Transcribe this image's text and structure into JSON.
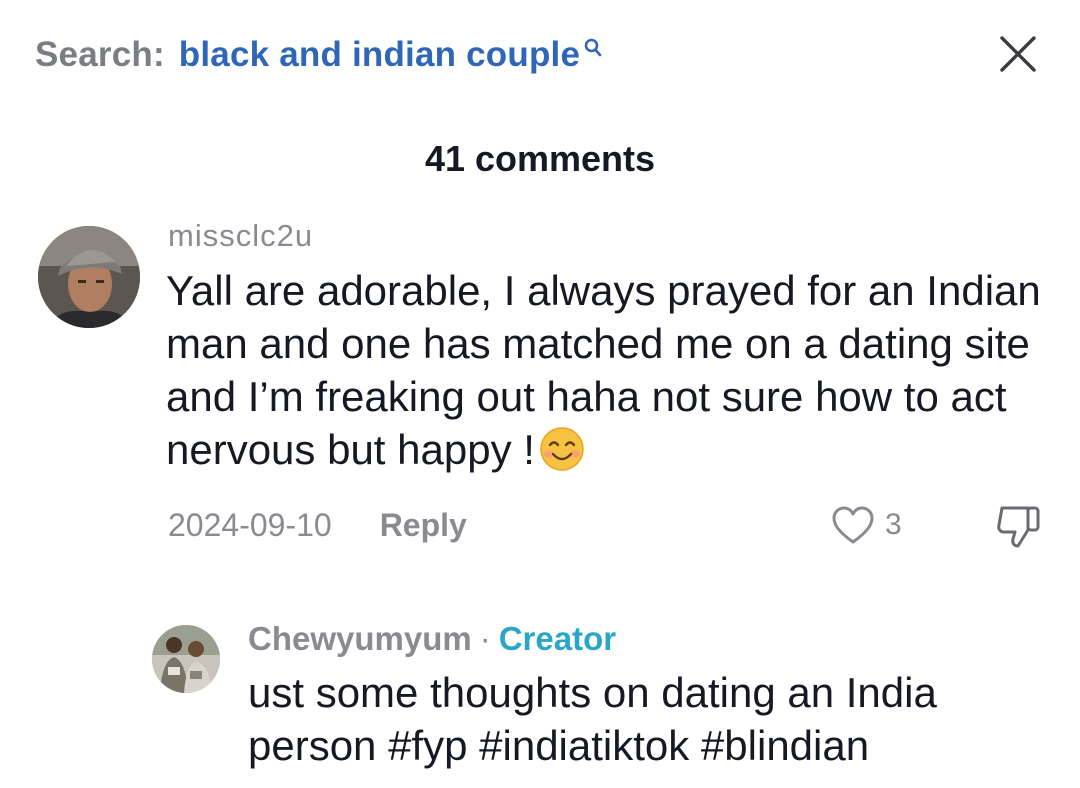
{
  "search": {
    "prefix": "Search:",
    "query": "black and indian couple"
  },
  "header": {
    "comments_count": "41 comments"
  },
  "comments": [
    {
      "username": "missclc2u",
      "text": "Yall are adorable, I always prayed for an Indian man and one has matched me on a dating site and I’m freaking out haha not sure how to act nervous but happy !",
      "emoji": "smiling-face-emoji",
      "date": "2024-09-10",
      "reply_label": "Reply",
      "likes": "3"
    }
  ],
  "reply": {
    "username": "Chewyumyum",
    "separator": "·",
    "badge": "Creator",
    "text": "ust some thoughts on dating an India person #fyp #indiatiktok #blindian"
  },
  "colors": {
    "query": "#2f66b8",
    "creator": "#2aa6c9",
    "muted": "#8a8b91",
    "text": "#161823"
  }
}
